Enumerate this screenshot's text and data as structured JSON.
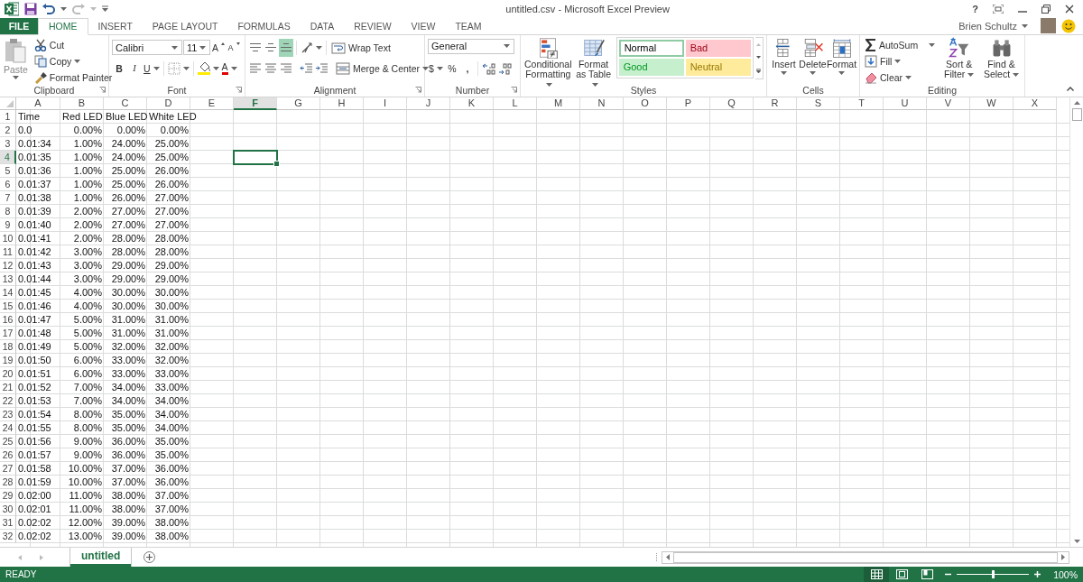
{
  "window": {
    "title": "untitled.csv - Microsoft Excel Preview",
    "help": "?"
  },
  "account": {
    "user": "Brien Schultz"
  },
  "tabs": [
    {
      "label": "FILE",
      "kind": "file",
      "selected": false
    },
    {
      "label": "HOME",
      "kind": "tab",
      "selected": true
    },
    {
      "label": "INSERT",
      "kind": "tab",
      "selected": false
    },
    {
      "label": "PAGE LAYOUT",
      "kind": "tab",
      "selected": false
    },
    {
      "label": "FORMULAS",
      "kind": "tab",
      "selected": false
    },
    {
      "label": "DATA",
      "kind": "tab",
      "selected": false
    },
    {
      "label": "REVIEW",
      "kind": "tab",
      "selected": false
    },
    {
      "label": "VIEW",
      "kind": "tab",
      "selected": false
    },
    {
      "label": "TEAM",
      "kind": "tab",
      "selected": false
    }
  ],
  "ribbon": {
    "groups": [
      {
        "kind": "clipboard",
        "label": "Clipboard",
        "paste": "Paste",
        "cut": "Cut",
        "copy": "Copy",
        "format_painter": "Format Painter"
      },
      {
        "kind": "font",
        "label": "Font",
        "font_name": "Calibri",
        "font_size": "11",
        "grow_font": "A",
        "shrink_font": "A",
        "bold": "B",
        "italic": "I",
        "underline": "U",
        "font_color": "A"
      },
      {
        "kind": "alignment",
        "label": "Alignment",
        "wrap_text": "Wrap Text",
        "merge": "Merge & Center",
        "vertical_align": [
          {
            "selected": false
          },
          {
            "selected": false
          },
          {
            "selected": true
          }
        ]
      },
      {
        "kind": "number",
        "label": "Number",
        "format": "General",
        "currency": "$",
        "percent": "%",
        "comma": ","
      },
      {
        "kind": "styles",
        "label": "Styles",
        "conditional": "Conditional Formatting",
        "format_table": "Format as Table",
        "cell_styles": [
          {
            "label": "Normal",
            "color": "#ffffff",
            "selected": true
          },
          {
            "label": "Bad",
            "color": "#ffc7ce",
            "selected": false
          },
          {
            "label": "Good",
            "color": "#c6efce",
            "selected": false
          },
          {
            "label": "Neutral",
            "color": "#ffeb9c",
            "selected": false
          }
        ]
      },
      {
        "kind": "cells",
        "label": "Cells",
        "buttons": [
          "Insert",
          "Delete",
          "Format"
        ]
      },
      {
        "kind": "editing",
        "label": "Editing",
        "autosum": "AutoSum",
        "fill": "Fill",
        "clear": "Clear",
        "sort": "Sort & Filter",
        "find": "Find & Select"
      }
    ]
  },
  "sheet": {
    "columns": [
      {
        "label": "A",
        "kind": "text",
        "selected": false
      },
      {
        "label": "B",
        "kind": "number",
        "selected": false
      },
      {
        "label": "C",
        "kind": "number",
        "selected": false
      },
      {
        "label": "D",
        "kind": "number",
        "selected": false
      },
      {
        "label": "E",
        "kind": "text",
        "selected": false
      },
      {
        "label": "F",
        "kind": "text",
        "selected": true
      },
      {
        "label": "G",
        "kind": "text",
        "selected": false
      },
      {
        "label": "H",
        "kind": "text",
        "selected": false
      },
      {
        "label": "I",
        "kind": "text",
        "selected": false
      },
      {
        "label": "J",
        "kind": "text",
        "selected": false
      },
      {
        "label": "K",
        "kind": "text",
        "selected": false
      },
      {
        "label": "L",
        "kind": "text",
        "selected": false
      },
      {
        "label": "M",
        "kind": "text",
        "selected": false
      },
      {
        "label": "N",
        "kind": "text",
        "selected": false
      },
      {
        "label": "O",
        "kind": "text",
        "selected": false
      },
      {
        "label": "P",
        "kind": "text",
        "selected": false
      },
      {
        "label": "Q",
        "kind": "text",
        "selected": false
      },
      {
        "label": "R",
        "kind": "text",
        "selected": false
      },
      {
        "label": "S",
        "kind": "text",
        "selected": false
      },
      {
        "label": "T",
        "kind": "text",
        "selected": false
      },
      {
        "label": "U",
        "kind": "text",
        "selected": false
      },
      {
        "label": "V",
        "kind": "text",
        "selected": false
      },
      {
        "label": "W",
        "kind": "text",
        "selected": false
      },
      {
        "label": "X",
        "kind": "text",
        "selected": false
      }
    ],
    "rows": [
      {
        "number": "1",
        "kind": "header",
        "selected": false,
        "cells": [
          "Time",
          "Red LED",
          "Blue LED",
          "White LED"
        ]
      },
      {
        "number": "2",
        "kind": "data",
        "selected": false,
        "cells": [
          "0.0",
          "0.00%",
          "0.00%",
          "0.00%"
        ]
      },
      {
        "number": "3",
        "kind": "data",
        "selected": false,
        "cells": [
          "0.01:34",
          "1.00%",
          "24.00%",
          "25.00%"
        ]
      },
      {
        "number": "4",
        "kind": "data",
        "selected": true,
        "cells": [
          "0.01:35",
          "1.00%",
          "24.00%",
          "25.00%"
        ]
      },
      {
        "number": "5",
        "kind": "data",
        "selected": false,
        "cells": [
          "0.01:36",
          "1.00%",
          "25.00%",
          "26.00%"
        ]
      },
      {
        "number": "6",
        "kind": "data",
        "selected": false,
        "cells": [
          "0.01:37",
          "1.00%",
          "25.00%",
          "26.00%"
        ]
      },
      {
        "number": "7",
        "kind": "data",
        "selected": false,
        "cells": [
          "0.01:38",
          "1.00%",
          "26.00%",
          "27.00%"
        ]
      },
      {
        "number": "8",
        "kind": "data",
        "selected": false,
        "cells": [
          "0.01:39",
          "2.00%",
          "27.00%",
          "27.00%"
        ]
      },
      {
        "number": "9",
        "kind": "data",
        "selected": false,
        "cells": [
          "0.01:40",
          "2.00%",
          "27.00%",
          "27.00%"
        ]
      },
      {
        "number": "10",
        "kind": "data",
        "selected": false,
        "cells": [
          "0.01:41",
          "2.00%",
          "28.00%",
          "28.00%"
        ]
      },
      {
        "number": "11",
        "kind": "data",
        "selected": false,
        "cells": [
          "0.01:42",
          "3.00%",
          "28.00%",
          "28.00%"
        ]
      },
      {
        "number": "12",
        "kind": "data",
        "selected": false,
        "cells": [
          "0.01:43",
          "3.00%",
          "29.00%",
          "29.00%"
        ]
      },
      {
        "number": "13",
        "kind": "data",
        "selected": false,
        "cells": [
          "0.01:44",
          "3.00%",
          "29.00%",
          "29.00%"
        ]
      },
      {
        "number": "14",
        "kind": "data",
        "selected": false,
        "cells": [
          "0.01:45",
          "4.00%",
          "30.00%",
          "30.00%"
        ]
      },
      {
        "number": "15",
        "kind": "data",
        "selected": false,
        "cells": [
          "0.01:46",
          "4.00%",
          "30.00%",
          "30.00%"
        ]
      },
      {
        "number": "16",
        "kind": "data",
        "selected": false,
        "cells": [
          "0.01:47",
          "5.00%",
          "31.00%",
          "31.00%"
        ]
      },
      {
        "number": "17",
        "kind": "data",
        "selected": false,
        "cells": [
          "0.01:48",
          "5.00%",
          "31.00%",
          "31.00%"
        ]
      },
      {
        "number": "18",
        "kind": "data",
        "selected": false,
        "cells": [
          "0.01:49",
          "5.00%",
          "32.00%",
          "32.00%"
        ]
      },
      {
        "number": "19",
        "kind": "data",
        "selected": false,
        "cells": [
          "0.01:50",
          "6.00%",
          "33.00%",
          "32.00%"
        ]
      },
      {
        "number": "20",
        "kind": "data",
        "selected": false,
        "cells": [
          "0.01:51",
          "6.00%",
          "33.00%",
          "33.00%"
        ]
      },
      {
        "number": "21",
        "kind": "data",
        "selected": false,
        "cells": [
          "0.01:52",
          "7.00%",
          "34.00%",
          "33.00%"
        ]
      },
      {
        "number": "22",
        "kind": "data",
        "selected": false,
        "cells": [
          "0.01:53",
          "7.00%",
          "34.00%",
          "34.00%"
        ]
      },
      {
        "number": "23",
        "kind": "data",
        "selected": false,
        "cells": [
          "0.01:54",
          "8.00%",
          "35.00%",
          "34.00%"
        ]
      },
      {
        "number": "24",
        "kind": "data",
        "selected": false,
        "cells": [
          "0.01:55",
          "8.00%",
          "35.00%",
          "34.00%"
        ]
      },
      {
        "number": "25",
        "kind": "data",
        "selected": false,
        "cells": [
          "0.01:56",
          "9.00%",
          "36.00%",
          "35.00%"
        ]
      },
      {
        "number": "26",
        "kind": "data",
        "selected": false,
        "cells": [
          "0.01:57",
          "9.00%",
          "36.00%",
          "35.00%"
        ]
      },
      {
        "number": "27",
        "kind": "data",
        "selected": false,
        "cells": [
          "0.01:58",
          "10.00%",
          "37.00%",
          "36.00%"
        ]
      },
      {
        "number": "28",
        "kind": "data",
        "selected": false,
        "cells": [
          "0.01:59",
          "10.00%",
          "37.00%",
          "36.00%"
        ]
      },
      {
        "number": "29",
        "kind": "data",
        "selected": false,
        "cells": [
          "0.02:00",
          "11.00%",
          "38.00%",
          "37.00%"
        ]
      },
      {
        "number": "30",
        "kind": "data",
        "selected": false,
        "cells": [
          "0.02:01",
          "11.00%",
          "38.00%",
          "37.00%"
        ]
      },
      {
        "number": "31",
        "kind": "data",
        "selected": false,
        "cells": [
          "0.02:02",
          "12.00%",
          "39.00%",
          "38.00%"
        ]
      },
      {
        "number": "32",
        "kind": "data",
        "selected": false,
        "cells": [
          "0.02:02",
          "13.00%",
          "39.00%",
          "38.00%"
        ]
      }
    ]
  },
  "sheet_tabs": [
    {
      "label": "untitled",
      "selected": true
    }
  ],
  "status_bar": {
    "mode": "READY",
    "views": [
      {
        "selected": true
      },
      {
        "selected": false
      },
      {
        "selected": false
      }
    ],
    "zoom": {
      "level": 0.5,
      "reading": "100%"
    }
  }
}
